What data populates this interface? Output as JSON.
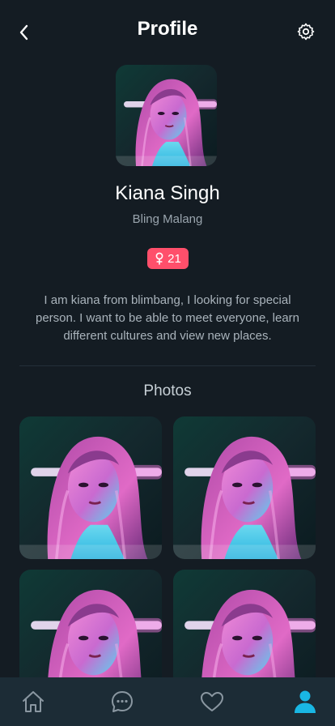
{
  "header": {
    "title": "Profile",
    "back_icon": "chevron-left-icon",
    "settings_icon": "gear-icon"
  },
  "profile": {
    "name": "Kiana Singh",
    "location": "Bling Malang",
    "gender_icon": "female-icon",
    "age": "21",
    "badge_color": "#ff4f6b",
    "bio": "I am kiana from blimbang, I looking for special person. I want to be able to meet everyone, learn different cultures and view new places."
  },
  "photos": {
    "title": "Photos",
    "count_visible": 4
  },
  "tabbar": {
    "items": [
      {
        "name": "home",
        "icon": "home-icon",
        "active": false
      },
      {
        "name": "messages",
        "icon": "chat-bubble-icon",
        "active": false
      },
      {
        "name": "favorites",
        "icon": "heart-icon",
        "active": false
      },
      {
        "name": "profile",
        "icon": "user-icon",
        "active": true
      }
    ],
    "active_color": "#19b7e4",
    "inactive_color": "#8a97a1"
  }
}
